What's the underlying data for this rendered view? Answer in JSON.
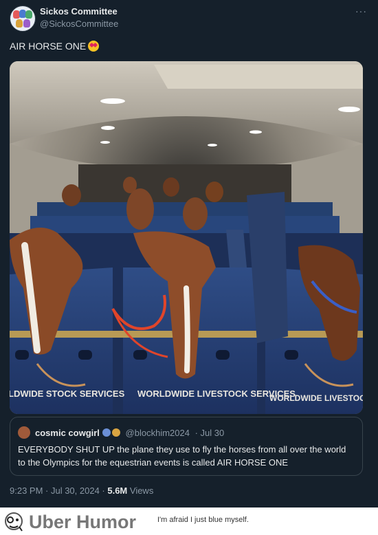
{
  "tweet": {
    "display_name": "Sickos Committee",
    "handle": "@SickosCommittee",
    "more_label": "···",
    "text": "AIR HORSE ONE",
    "emoji": "heart-eyes-emoji",
    "photo": {
      "crate_labels": [
        "LDWIDE STOCK SERVICES",
        "WORLDWIDE LIVESTOCK SERVICES",
        "WORLDWIDE LIVESTOCK SERVICES"
      ]
    },
    "quote": {
      "display_name": "cosmic cowgirl",
      "handle": "@blockhim2024",
      "date": "· Jul 30",
      "text": "EVERYBODY SHUT UP the plane they use to fly the horses from all over the world to the Olympics for the equestrian events is called AIR HORSE ONE"
    },
    "timestamp": "9:23 PM · Jul 30, 2024 · ",
    "views_count": "5.6M",
    "views_label": " Views"
  },
  "brand": {
    "name": "Uber Humor",
    "caption": "I'm afraid I just blue myself."
  },
  "colors": {
    "background": "#15202b",
    "text": "#e7e9ea",
    "muted": "#8b98a5",
    "border": "#38444d"
  }
}
